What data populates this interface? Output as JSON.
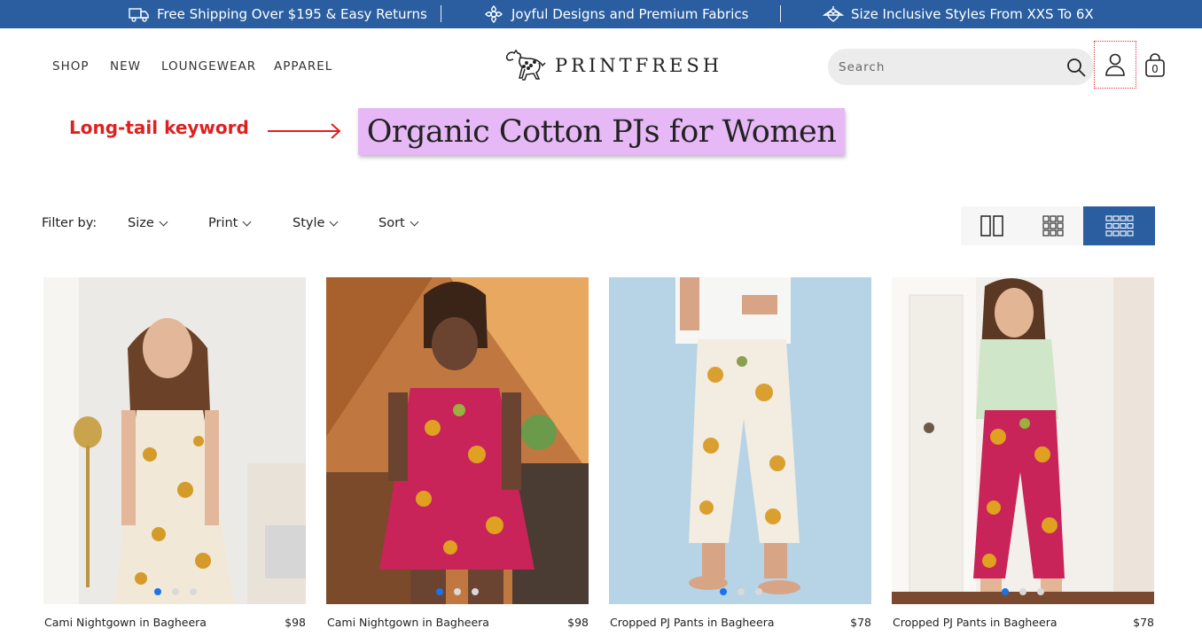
{
  "announcement": {
    "items": [
      {
        "icon": "truck-icon",
        "text": "Free Shipping Over $195 & Easy Returns"
      },
      {
        "icon": "flower-icon",
        "text": "Joyful Designs and Premium Fabrics"
      },
      {
        "icon": "heart-hanger-icon",
        "text": "Size Inclusive Styles From XXS To 6X"
      }
    ],
    "bg_color": "#2a5ea0"
  },
  "header": {
    "nav": [
      "SHOP",
      "NEW",
      "LOUNGEWEAR",
      "APPAREL"
    ],
    "logo_text": "PRINTFRESH",
    "search_placeholder": "Search",
    "bag_count": "0"
  },
  "annotation": {
    "label": "Long-tail keyword",
    "color": "#e02020"
  },
  "page": {
    "title": "Organic Cotton PJs for Women",
    "title_highlight": "#e6b8f5"
  },
  "filters": {
    "label": "Filter by:",
    "options": [
      "Size",
      "Print",
      "Style",
      "Sort"
    ]
  },
  "view_toggle": {
    "options": [
      "two-column-icon",
      "three-column-icon",
      "four-column-icon"
    ],
    "active": "four-column-icon"
  },
  "products": [
    {
      "name": "Cami Nightgown in Bagheera",
      "price": "$98",
      "image_count": 3,
      "active_image": 1
    },
    {
      "name": "Cami Nightgown in Bagheera",
      "price": "$98",
      "image_count": 3,
      "active_image": 1
    },
    {
      "name": "Cropped PJ Pants in Bagheera",
      "price": "$78",
      "image_count": 3,
      "active_image": 1
    },
    {
      "name": "Cropped PJ Pants in Bagheera",
      "price": "$78",
      "image_count": 3,
      "active_image": 1
    }
  ]
}
